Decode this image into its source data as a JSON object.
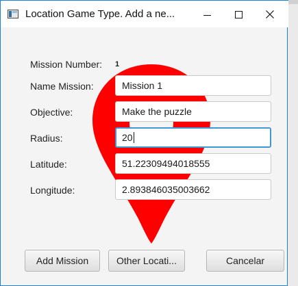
{
  "window": {
    "title": "Location Game Type. Add a ne..."
  },
  "form": {
    "mission_number_label": "Mission Number:",
    "mission_number_value": "1",
    "name_label": "Name Mission:",
    "name_value": "Mission 1",
    "objective_label": "Objective:",
    "objective_value": "Make the puzzle",
    "radius_label": "Radius:",
    "radius_value": "20",
    "latitude_label": "Latitude:",
    "latitude_value": "51.22309494018555",
    "longitude_label": "Longitude:",
    "longitude_value": "2.893846035003662"
  },
  "buttons": {
    "add_mission": "Add Mission",
    "other_location": "Other Locati...",
    "cancel": "Cancelar"
  },
  "background": {
    "pin_icon": "map-pin-icon",
    "pin_color": "#ff0000"
  }
}
